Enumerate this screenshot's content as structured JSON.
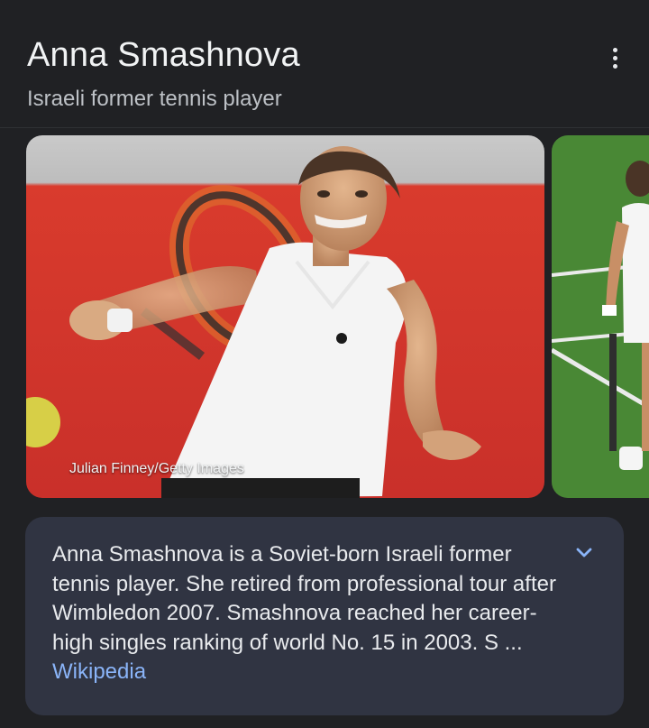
{
  "header": {
    "title": "Anna Smashnova",
    "subtitle": "Israeli former tennis player",
    "more_icon": "more-vert-icon"
  },
  "images": [
    {
      "credit": "Julian Finney/Getty Images"
    },
    {
      "credit": ""
    }
  ],
  "description": {
    "text": "Anna Smashnova is a Soviet-born Israeli former tennis player. She retired from professional tour after Wimbledon 2007. Smashnova reached her career-high singles ranking of world No. 15 in 2003. S ...",
    "source_link": "Wikipedia",
    "expand_icon": "chevron-down-icon"
  },
  "colors": {
    "background": "#202124",
    "card": "#303442",
    "link": "#8ab4f8",
    "court_red": "#d63a2c",
    "grass_green": "#4f8f3a"
  }
}
